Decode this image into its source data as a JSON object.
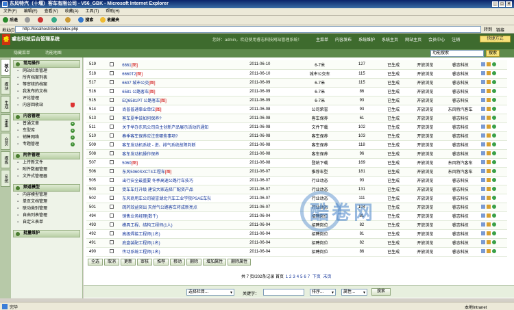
{
  "window": {
    "title": "东风特汽（十堰）客车有限公司 - V56_GBK - Microsoft Internet Explorer",
    "menu": [
      "文件(F)",
      "编辑(E)",
      "查看(V)",
      "收藏(A)",
      "工具(T)",
      "帮助(H)"
    ],
    "toolbar": {
      "back": "后退",
      "search": "搜索",
      "favorites": "收藏夹"
    },
    "address_label": "地址(D)",
    "address": "http://localhost/dede/index.php",
    "go_label": "转到",
    "links_label": "链接",
    "status_left": "完毕",
    "status_right": "本地Intranet",
    "watermark": "酷卷网"
  },
  "header": {
    "logo": "睿",
    "app_title": "睿志科技后台管理系统",
    "welcome": "您好：admin，欢迎使用睿志科技网站管理系统！",
    "topnav": [
      "主菜单",
      "内容发布",
      "系统维护",
      "系统主页",
      "网站主页",
      "会员中心",
      "注销"
    ],
    "quick_menu": "快捷方式"
  },
  "subnav": {
    "hide_menu": "隐藏菜单",
    "site_map": "功能地图",
    "search_value": "功能搜索",
    "search_button": "搜索"
  },
  "vtabs": [
    "核心",
    "模块",
    "生成",
    "采集",
    "会员",
    "模板",
    "系统"
  ],
  "leftmenu": [
    {
      "title": "常用操作",
      "items": [
        "网站栏目管理",
        "所有档案列表",
        "等审核的档案",
        "我发布的文档",
        "评论管理",
        "内容回收站"
      ]
    },
    {
      "title": "内容管理",
      "items": [
        "普通文章",
        "车型库",
        "销售网络",
        "专题管理"
      ]
    },
    {
      "title": "附件管理",
      "items": [
        "上传新文件",
        "附件数据管理",
        "文件式管理器"
      ]
    },
    {
      "title": "频道模型",
      "items": [
        "内容模型管理",
        "单页文档管理",
        "联动类别管理",
        "自由列表管理",
        "自定义表单"
      ]
    },
    {
      "title": "批量维护",
      "items": []
    }
  ],
  "rows": [
    {
      "id": "519",
      "title": "6661",
      "tag": "[图]",
      "date": "2011-06-10",
      "cat": "6-7米",
      "hits": "127",
      "status": "已生成",
      "perm": "开放浏览",
      "pub": "睿志科技"
    },
    {
      "id": "518",
      "title": "6660T2",
      "tag": "[图]",
      "date": "2011-06-10",
      "cat": "城市公交车",
      "hits": "115",
      "status": "已生成",
      "perm": "开放浏览",
      "pub": "睿志科技"
    },
    {
      "id": "517",
      "title": "6607 城市公交",
      "tag": "[图]",
      "date": "2011-06-09",
      "cat": "6-7米",
      "hits": "115",
      "status": "已生成",
      "perm": "开放浏览",
      "pub": "睿志科技"
    },
    {
      "id": "516",
      "title": "6581 公路客车",
      "tag": "[图]",
      "date": "2011-06-09",
      "cat": "6-7米",
      "hits": "86",
      "status": "已生成",
      "perm": "开放浏览",
      "pub": "睿志科技"
    },
    {
      "id": "515",
      "title": "EQ6581PT 公路客车",
      "tag": "[图]",
      "date": "2011-06-09",
      "cat": "6-7米",
      "hits": "93",
      "status": "已生成",
      "perm": "开放浏览",
      "pub": "睿志科技"
    },
    {
      "id": "514",
      "title": "尚普普通事业单位",
      "tag": "[图]",
      "date": "2011-06-08",
      "cat": "公司荣誉",
      "hits": "93",
      "status": "已生成",
      "perm": "开放浏览",
      "pub": "东风特汽客车"
    },
    {
      "id": "513",
      "title": "客车夏季该如何保养?",
      "tag": "",
      "date": "2011-06-08",
      "cat": "客车保养",
      "hits": "61",
      "status": "已生成",
      "perm": "开放浏览",
      "pub": "睿志科技"
    },
    {
      "id": "511",
      "title": "关于举办东风公司自主创新产品展示活动的通知",
      "tag": "",
      "date": "2011-06-08",
      "cat": "文件下载",
      "hits": "102",
      "status": "已生成",
      "perm": "开放浏览",
      "pub": "睿志科技"
    },
    {
      "id": "510",
      "title": "春季客车保养应注意哪些事项?",
      "tag": "",
      "date": "2011-06-08",
      "cat": "客车保养",
      "hits": "103",
      "status": "已生成",
      "perm": "开放浏览",
      "pub": "睿志科技"
    },
    {
      "id": "509",
      "title": "客车发动机系统 - 进、排气系统故障判断",
      "tag": "",
      "date": "2011-06-08",
      "cat": "客车保养",
      "hits": "118",
      "status": "已生成",
      "perm": "开放浏览",
      "pub": "睿志科技"
    },
    {
      "id": "508",
      "title": "客车发动机操作保养",
      "tag": "",
      "date": "2011-06-08",
      "cat": "客车保养",
      "hits": "96",
      "status": "已生成",
      "perm": "开放浏览",
      "pub": "睿志科技"
    },
    {
      "id": "507",
      "title": "5060",
      "tag": "[图]",
      "date": "2011-06-08",
      "cat": "登统下载",
      "hits": "169",
      "status": "已生成",
      "perm": "开放浏览",
      "pub": "东风特汽客车"
    },
    {
      "id": "506",
      "title": "东风5060SXCT4工程车",
      "tag": "[图]",
      "date": "2011-06-07",
      "cat": "推荐车型",
      "hits": "181",
      "status": "已生成",
      "perm": "开放浏览",
      "pub": "东风特汽客车"
    },
    {
      "id": "505",
      "title": "出行安全最重要 冬季高速公路行车技巧",
      "tag": "",
      "date": "2011-06-07",
      "cat": "行业动态",
      "hits": "93",
      "status": "已生成",
      "perm": "开放浏览",
      "pub": "睿志科技"
    },
    {
      "id": "503",
      "title": "受车车灯升级 建议大家选择厂配资产品",
      "tag": "",
      "date": "2011-06-07",
      "cat": "行业动态",
      "hits": "131",
      "status": "已生成",
      "perm": "开放浏览",
      "pub": "睿志科技"
    },
    {
      "id": "502",
      "title": "东风商用车公司被誉湖北汽车工业学院PSAE车队",
      "tag": "",
      "date": "2011-06-07",
      "cat": "行业动态",
      "hits": "111",
      "status": "已生成",
      "perm": "开放浏览",
      "pub": "睿志科技"
    },
    {
      "id": "501",
      "title": "疏药效益突出 天然气公路客车将成新亮点",
      "tag": "",
      "date": "2011-06-07",
      "cat": "行业动态",
      "hits": "104",
      "status": "已生成",
      "perm": "开放浏览",
      "pub": "睿志科技"
    },
    {
      "id": "494",
      "title": "销售业务经理(数千)",
      "tag": "",
      "date": "2011-06-04",
      "cat": "招聘岗位",
      "hits": "81",
      "status": "已生成",
      "perm": "开放浏览",
      "pub": "睿志科技"
    },
    {
      "id": "493",
      "title": "模具工程、结构工程师(1人)",
      "tag": "",
      "date": "2011-06-04",
      "cat": "招聘岗位",
      "hits": "82",
      "status": "已生成",
      "perm": "开放浏览",
      "pub": "睿志科技"
    },
    {
      "id": "492",
      "title": "高级焊接工程师(1名)",
      "tag": "",
      "date": "2011-06-04",
      "cat": "招聘岗位",
      "hits": "81",
      "status": "已生成",
      "perm": "开放浏览",
      "pub": "睿志科技"
    },
    {
      "id": "491",
      "title": "底盘装配工程师(1名)",
      "tag": "",
      "date": "2011-06-04",
      "cat": "招聘岗位",
      "hits": "82",
      "status": "已生成",
      "perm": "开放浏览",
      "pub": "睿志科技"
    },
    {
      "id": "490",
      "title": "传动系统工程师(1名)",
      "tag": "",
      "date": "2011-06-04",
      "cat": "招聘岗位",
      "hits": "86",
      "status": "已生成",
      "perm": "开放浏览",
      "pub": "睿志科技"
    }
  ],
  "actions": [
    "全选",
    "取消",
    "更新",
    "审核",
    "推荐",
    "移动",
    "删除",
    "增加属性",
    "删除属性"
  ],
  "pager": {
    "prefix": "共 7 页/202条记录 首页",
    "pages": [
      "1",
      "2",
      "3",
      "4",
      "5",
      "6",
      "7"
    ],
    "next": "下页",
    "last": "末页"
  },
  "filter": {
    "category": "选择栏目...",
    "keyword_label": "关键字：",
    "sort": "排序...",
    "attr": "属性...",
    "search": "搜索"
  }
}
